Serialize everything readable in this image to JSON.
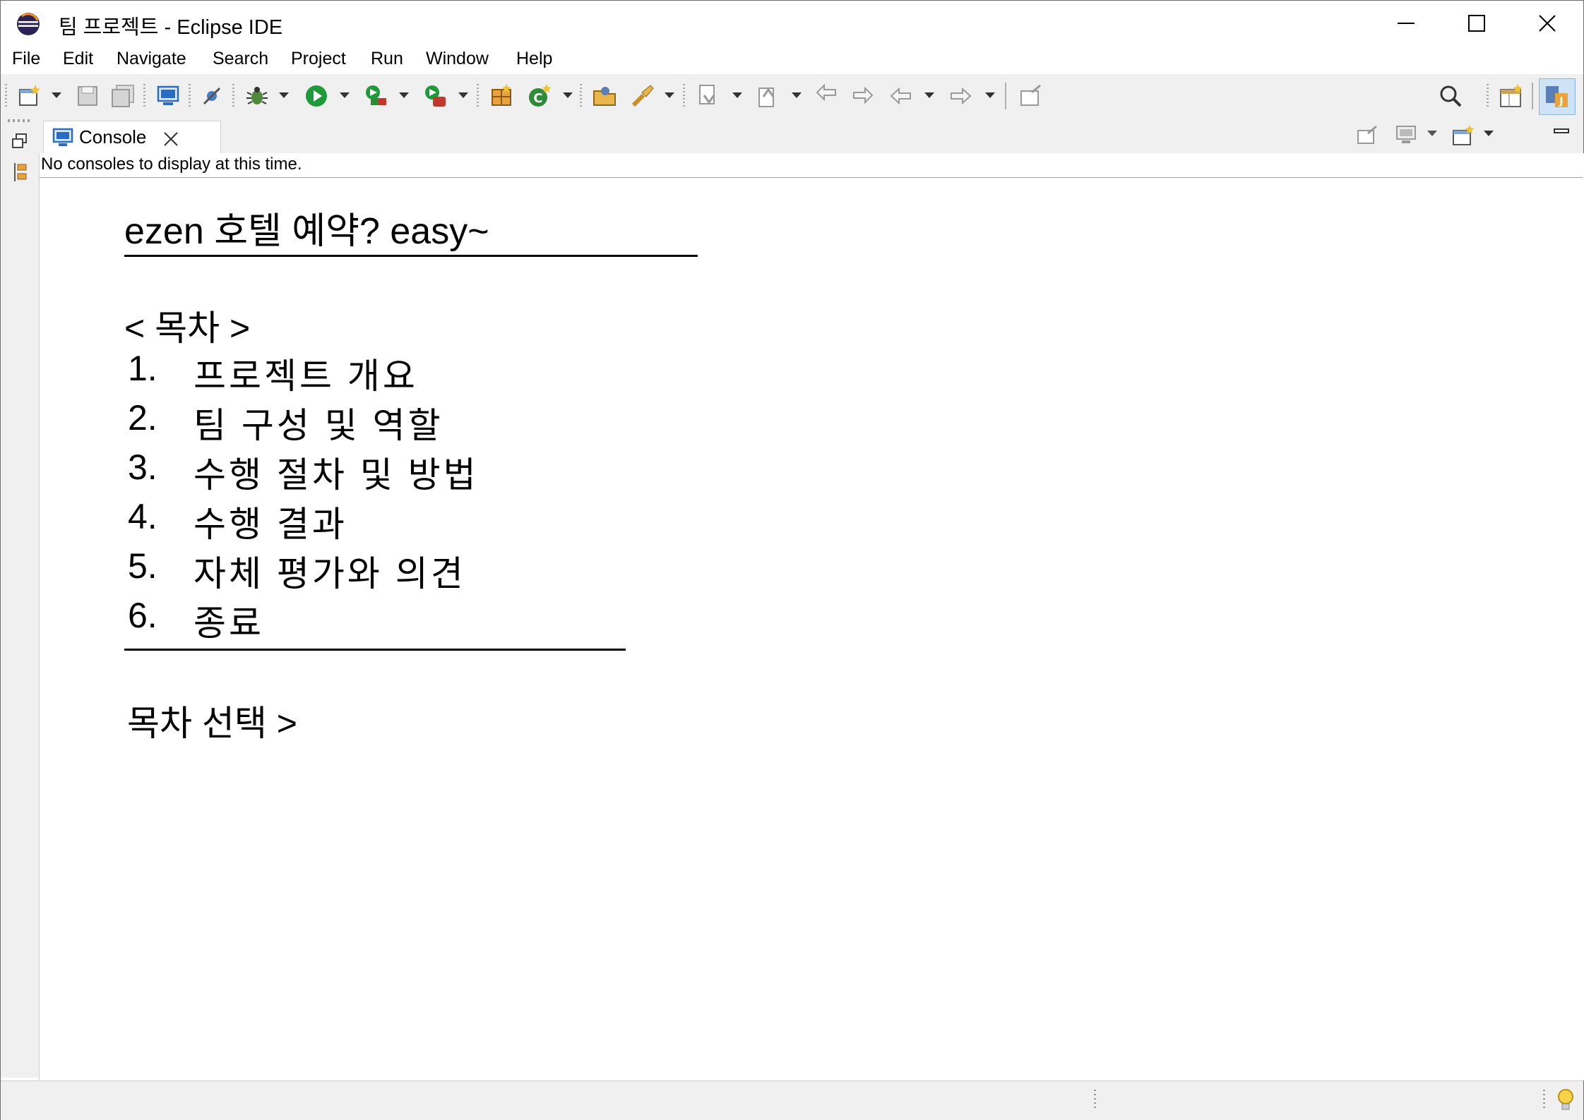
{
  "window": {
    "title": "팀 프로젝트 - Eclipse IDE"
  },
  "menu": [
    "File",
    "Edit",
    "Navigate",
    "Search",
    "Project",
    "Run",
    "Window",
    "Help"
  ],
  "console": {
    "tab_label": "Console",
    "message": "No consoles to display at this time."
  },
  "content": {
    "heading": "ezen 호텔 예약? easy~",
    "toc_title": "< 목차 >",
    "toc_items": [
      {
        "num": "1.",
        "label": "프로젝트 개요"
      },
      {
        "num": "2.",
        "label": "팀 구성 및 역할"
      },
      {
        "num": "3.",
        "label": "수행 절차 및 방법"
      },
      {
        "num": "4.",
        "label": "수행 결과"
      },
      {
        "num": "5.",
        "label": "자체 평가와 의견"
      },
      {
        "num": "6.",
        "label": "종료"
      }
    ],
    "prompt": "목차 선택 >"
  },
  "colors": {
    "chrome": "#f0f0f0",
    "accent_blue": "#2a6bc4",
    "run_green": "#1e9a3a"
  }
}
